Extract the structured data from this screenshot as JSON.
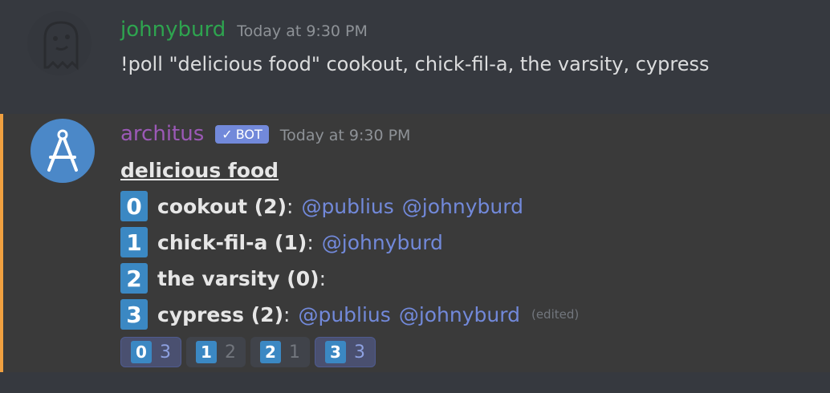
{
  "message1": {
    "username": "johnyburd",
    "timestamp": "Today at 9:30 PM",
    "content": "!poll \"delicious food\" cookout, chick-fil-a, the varsity, cypress"
  },
  "message2": {
    "username": "architus",
    "bot_badge": "BOT",
    "timestamp": "Today at 9:30 PM",
    "poll_title": "delicious food",
    "options": [
      {
        "num": "0",
        "label": "cookout (2)",
        "mentions": [
          "@publius",
          "@johnyburd"
        ]
      },
      {
        "num": "1",
        "label": "chick-fil-a (1)",
        "mentions": [
          "@johnyburd"
        ]
      },
      {
        "num": "2",
        "label": "the varsity (0)",
        "mentions": []
      },
      {
        "num": "3",
        "label": "cypress (2)",
        "mentions": [
          "@publius",
          "@johnyburd"
        ],
        "edited": "(edited)"
      }
    ],
    "reactions": [
      {
        "emoji": "0",
        "count": "3",
        "active": true
      },
      {
        "emoji": "1",
        "count": "2",
        "active": false
      },
      {
        "emoji": "2",
        "count": "1",
        "active": false
      },
      {
        "emoji": "3",
        "count": "3",
        "active": true
      }
    ]
  },
  "colors": {
    "background": "#36393f",
    "highlight_bar": "#f0a040",
    "mention": "#7289da",
    "keycap": "#3b88c3",
    "username1": "#2ea44f",
    "username2": "#9b59b6"
  }
}
